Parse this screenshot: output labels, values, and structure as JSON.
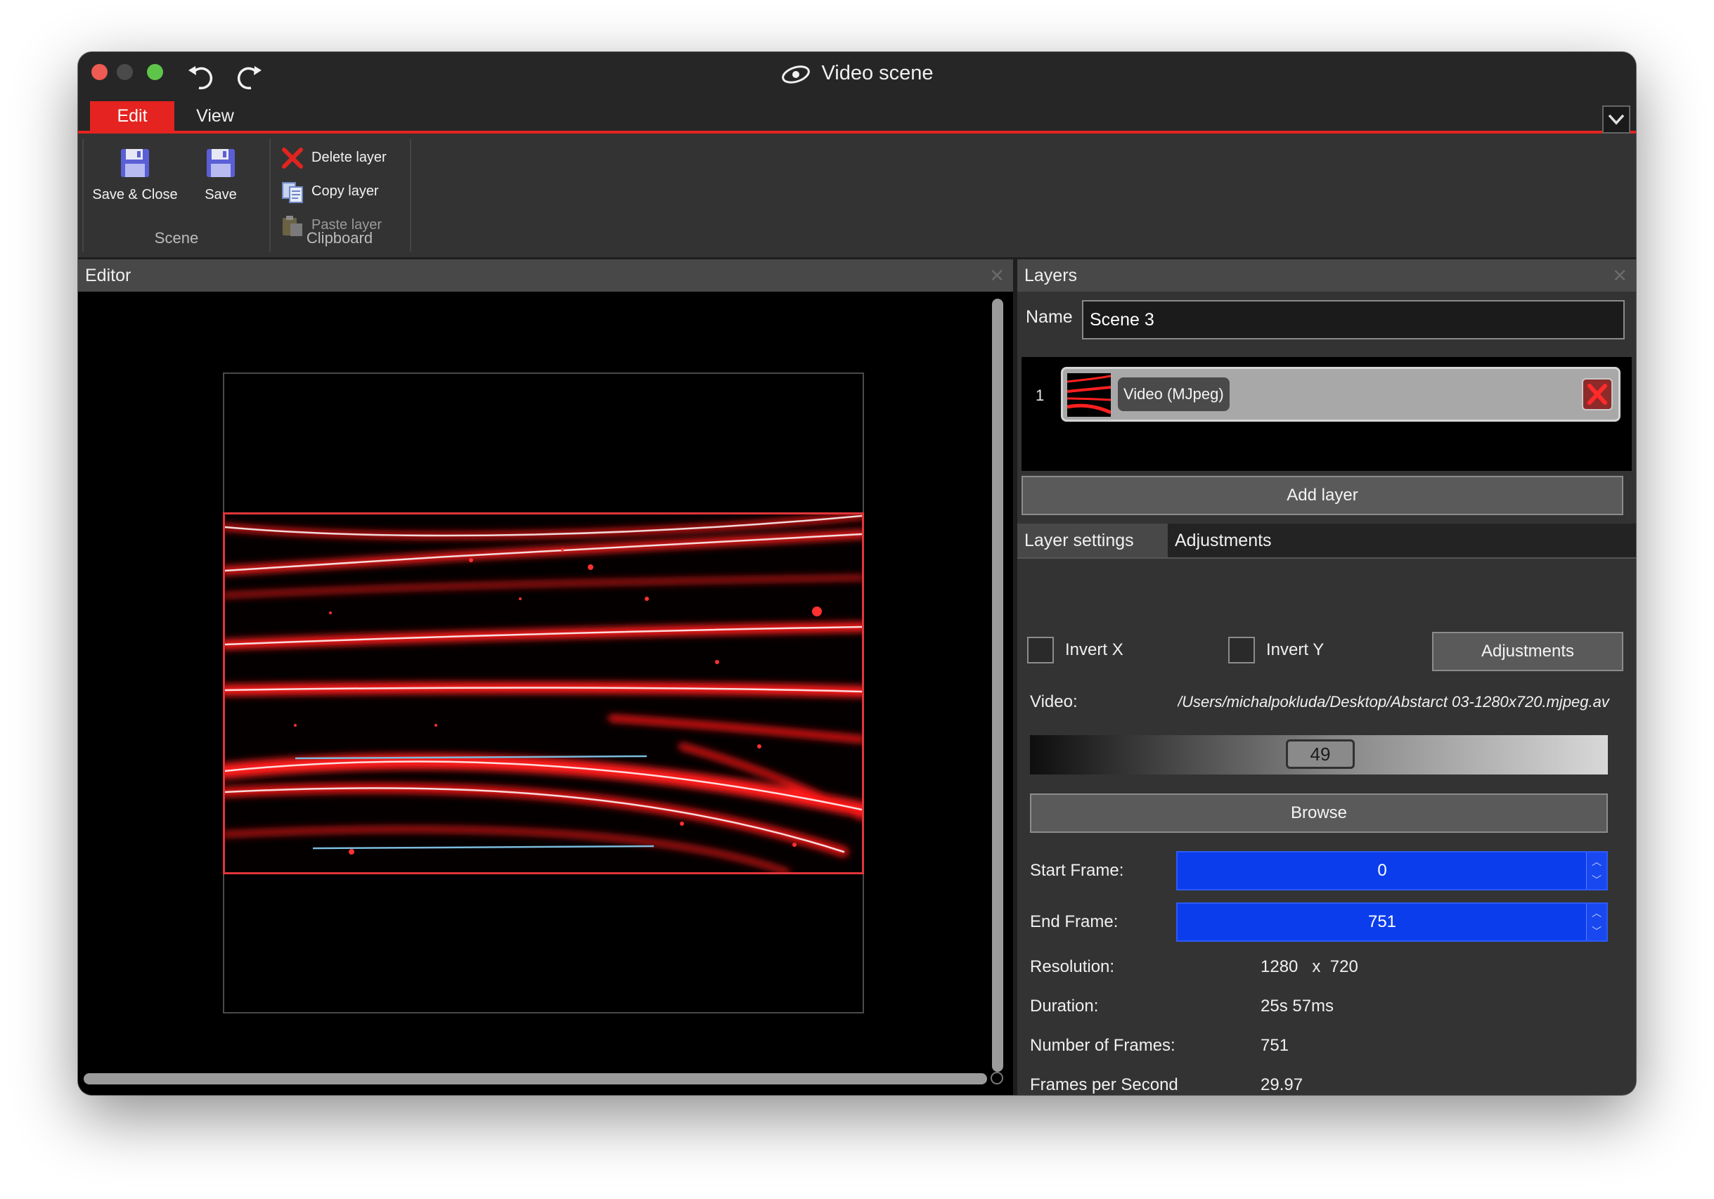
{
  "window": {
    "title": "Video scene"
  },
  "menu": {
    "edit": "Edit",
    "view": "View"
  },
  "ribbon": {
    "scene_group": "Scene",
    "save_close": "Save & Close",
    "save": "Save",
    "clipboard_group": "Clipboard",
    "delete_layer": "Delete layer",
    "copy_layer": "Copy layer",
    "paste_layer": "Paste layer"
  },
  "editor": {
    "title": "Editor",
    "close": "✕"
  },
  "layers": {
    "title": "Layers",
    "close": "✕",
    "name_label": "Name",
    "name_value": "Scene 3",
    "items": [
      {
        "index": "1",
        "name": "Video (MJpeg)"
      }
    ],
    "add_layer": "Add layer"
  },
  "tabs": {
    "layer_settings": "Layer settings",
    "adjustments": "Adjustments"
  },
  "settings": {
    "invert_x": "Invert X",
    "invert_y": "Invert Y",
    "adjustments_button": "Adjustments",
    "video_label": "Video:",
    "video_path": "/Users/michalpokluda/Desktop/Abstarct 03-1280x720.mjpeg.av",
    "slider_value": "49",
    "browse": "Browse",
    "start_frame_label": "Start Frame:",
    "start_frame": "0",
    "end_frame_label": "End Frame:",
    "end_frame": "751",
    "resolution_label": "Resolution:",
    "resolution_w": "1280",
    "resolution_x": "x",
    "resolution_h": "720",
    "duration_label": "Duration:",
    "duration": "25s 57ms",
    "frames_label": "Number of Frames:",
    "frames": "751",
    "fps_label": "Frames per Second",
    "fps": "29.97"
  },
  "colors": {
    "accent": "#e52320",
    "spin_blue": "#0b3ded"
  },
  "icons": {
    "undo": "undo-icon",
    "redo": "redo-icon",
    "logo": "app-logo-icon",
    "save": "floppy-disk-icon",
    "delete": "red-x-icon",
    "copy": "copy-icon",
    "paste": "clipboard-icon",
    "collapse": "chevron-down-icon"
  }
}
